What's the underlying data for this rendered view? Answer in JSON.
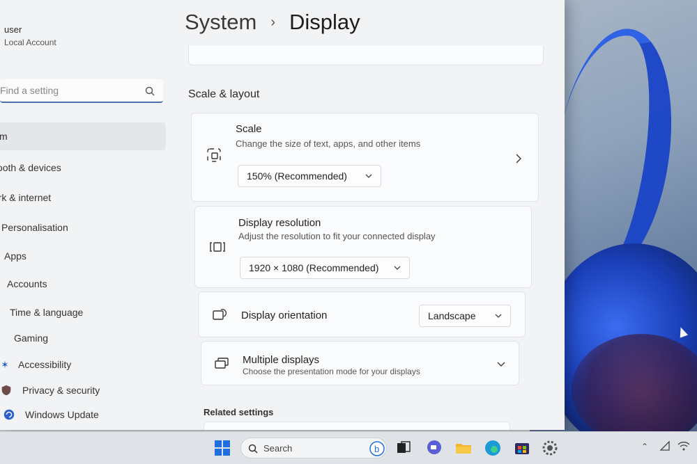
{
  "user": {
    "name": "user",
    "account": "Local Account"
  },
  "search": {
    "placeholder": "Find a setting"
  },
  "nav": [
    {
      "label": "System",
      "icon": "laptop-icon",
      "active": true
    },
    {
      "label": "Bluetooth & devices",
      "icon": "bluetooth-icon"
    },
    {
      "label": "Network & internet",
      "icon": "wifi-icon"
    },
    {
      "label": "Personalisation",
      "icon": "brush-icon"
    },
    {
      "label": "Apps",
      "icon": "apps-icon"
    },
    {
      "label": "Accounts",
      "icon": "person-icon"
    },
    {
      "label": "Time & language",
      "icon": "globe-icon"
    },
    {
      "label": "Gaming",
      "icon": "gamepad-icon"
    },
    {
      "label": "Accessibility",
      "icon": "accessibility-icon"
    },
    {
      "label": "Privacy & security",
      "icon": "shield-icon"
    },
    {
      "label": "Windows Update",
      "icon": "update-icon"
    }
  ],
  "breadcrumb": {
    "parent": "System",
    "separator": "›",
    "current": "Display"
  },
  "section": {
    "title": "Scale & layout"
  },
  "cards": {
    "scale": {
      "title": "Scale",
      "desc": "Change the size of text, apps, and other items",
      "value": "150% (Recommended)"
    },
    "resolution": {
      "title": "Display resolution",
      "desc": "Adjust the resolution to fit your connected display",
      "value": "1920 × 1080 (Recommended)"
    },
    "orientation": {
      "title": "Display orientation",
      "value": "Landscape"
    },
    "multiple": {
      "title": "Multiple displays",
      "desc": "Choose the presentation mode for your displays"
    }
  },
  "related": {
    "title": "Related settings"
  },
  "taskbar": {
    "search_label": "Search"
  },
  "colors": {
    "accent": "#4a6fb0",
    "window_bg": "#f2f3f5",
    "card_bg": "#fafbfc",
    "wallpaper_blue": "#1a44c8"
  }
}
